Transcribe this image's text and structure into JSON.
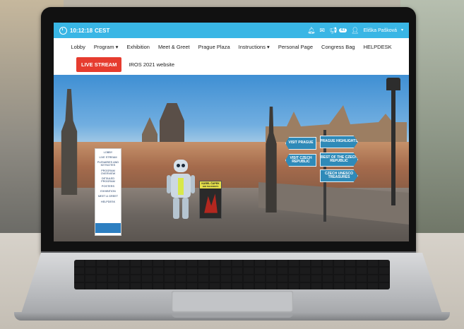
{
  "topbar": {
    "time": "10:12:18",
    "timezone": "CEST",
    "notifications_count": "47",
    "user_name": "Eliška Pašková"
  },
  "nav": {
    "items": [
      "Lobby",
      "Program ▾",
      "Exhibition",
      "Meet & Greet",
      "Prague Plaza",
      "Instructions ▾",
      "Personal Page",
      "Congress Bag",
      "HELPDESK"
    ],
    "live_stream": "LIVE STREAM",
    "iros_link": "IROS 2021 website"
  },
  "scene": {
    "menu_banner": [
      "LOBBY",
      "LIVE STREAM",
      "PLENARIES AND KEYNOTES",
      "PROGRAM OVERVIEW",
      "DETAILED PROGRAM",
      "POSTERS",
      "EXHIBITION",
      "MEET & GREET",
      "HELPDESK"
    ],
    "poster_title": "KAREL ČAPEK",
    "poster_subtitle": "AND THE ROBOTS",
    "signs": [
      "VISIT PRAGUE",
      "PRAGUE HIGHLIGHTS",
      "VISIT CZECH REPUBLIC",
      "BEST OF THE CZECH REPUBLIC",
      "CZECH UNESCO TREASURES"
    ]
  },
  "colors": {
    "topbar": "#39b6e5",
    "live_button": "#e63c2f",
    "sign_blue": "#2f8ab8"
  },
  "icons": [
    "clock-icon",
    "bell-icon",
    "mail-icon",
    "megaphone-icon",
    "user-icon"
  ]
}
